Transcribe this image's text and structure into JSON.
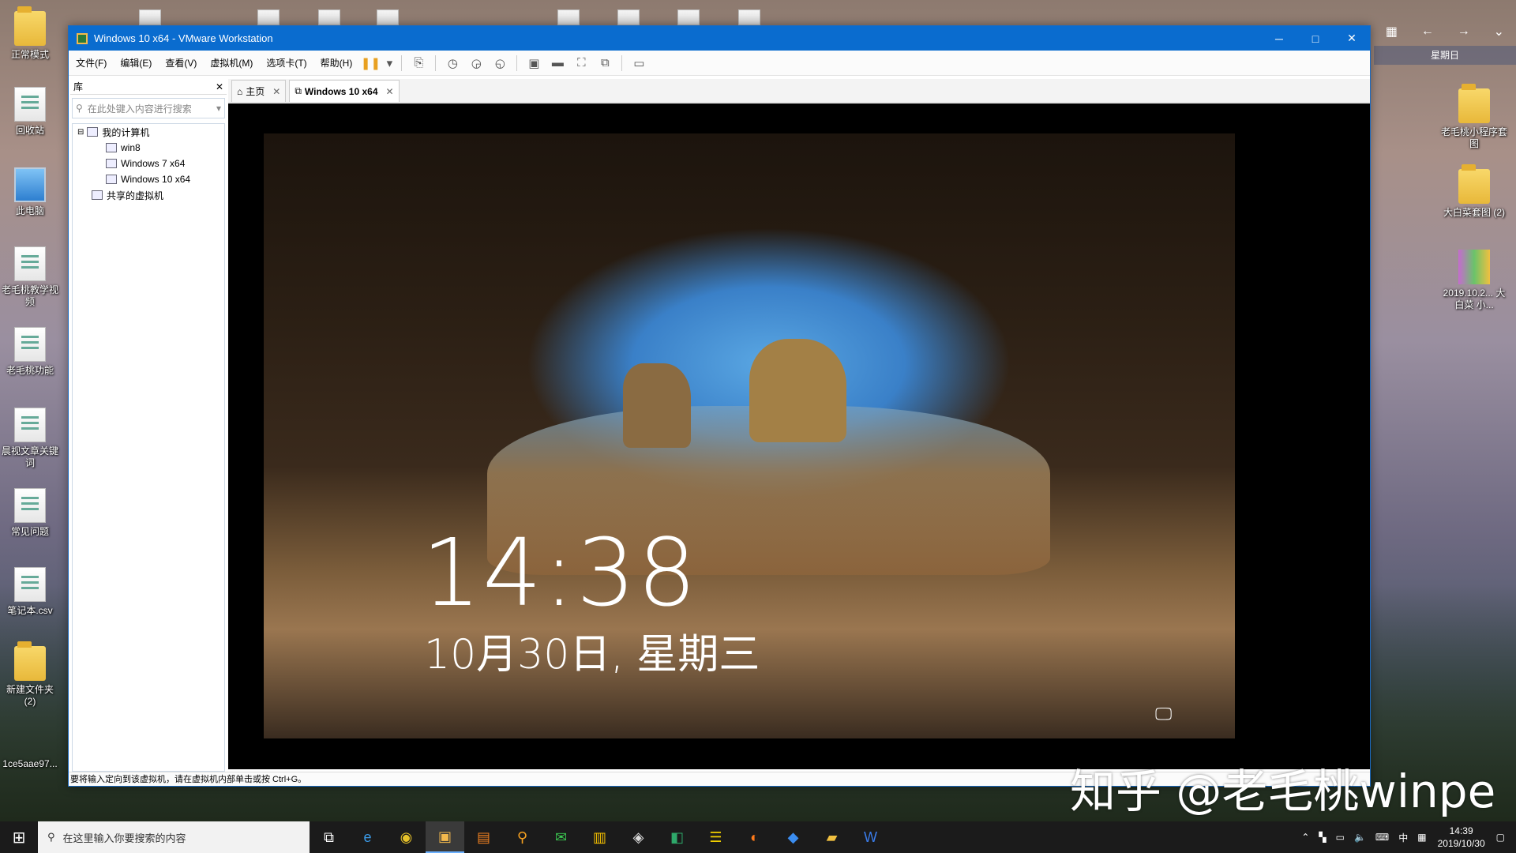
{
  "window": {
    "title": "Windows 10 x64 - VMware Workstation",
    "minimize": "─",
    "maximize": "□",
    "close": "✕"
  },
  "menu": [
    "文件(F)",
    "编辑(E)",
    "查看(V)",
    "虚拟机(M)",
    "选项卡(T)",
    "帮助(H)"
  ],
  "library": {
    "title": "库",
    "search_placeholder": "在此处键入内容进行搜索",
    "tree": [
      {
        "label": "我的计算机",
        "level": 0
      },
      {
        "label": "win8",
        "level": 1
      },
      {
        "label": "Windows 7 x64",
        "level": 1
      },
      {
        "label": "Windows 10 x64",
        "level": 1
      },
      {
        "label": "共享的虚拟机",
        "level": 0
      }
    ]
  },
  "tabs": [
    {
      "label": "主页",
      "active": false
    },
    {
      "label": "Windows 10 x64",
      "active": true
    }
  ],
  "lockscreen": {
    "time": "14:38",
    "date": "10月30日, 星期三"
  },
  "status": "要将输入定向到该虚拟机，请在虚拟机内部单击或按 Ctrl+G。",
  "desktop_left": [
    {
      "label": "正常模式",
      "type": "folder"
    },
    {
      "label": "回收站",
      "type": "bin"
    },
    {
      "label": "此电脑",
      "type": "pc"
    },
    {
      "label": "老毛桃教学视频",
      "type": "doc"
    },
    {
      "label": "老毛桃功能",
      "type": "doc"
    },
    {
      "label": "晨视文章关键词",
      "type": "doc"
    },
    {
      "label": "常见问题",
      "type": "doc"
    },
    {
      "label": "笔记本.csv",
      "type": "doc"
    },
    {
      "label": "新建文件夹 (2)",
      "type": "folder"
    },
    {
      "label": "1ce5aae97...",
      "type": "doc"
    }
  ],
  "desktop_right": [
    {
      "label": "老毛桃小程序套图"
    },
    {
      "label": "大白菜套图 (2)"
    },
    {
      "label": "2019.10.2... 大白菜 小..."
    }
  ],
  "right_header": "星期日",
  "taskbar": {
    "search_placeholder": "在这里输入你要搜索的内容",
    "time": "14:39",
    "date": "2019/10/30",
    "ime": "中"
  },
  "watermark": "知乎 @老毛桃winpe"
}
